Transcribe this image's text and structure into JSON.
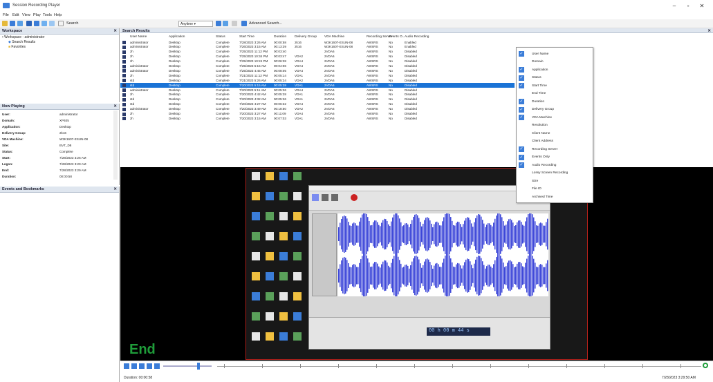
{
  "window": {
    "title": "Session Recording Player"
  },
  "menu": [
    "File",
    "Edit",
    "View",
    "Play",
    "Tools",
    "Help"
  ],
  "toolbar": {
    "search_label": "Search",
    "time_filter": "Anytime",
    "advanced_search": "Advanced Search..."
  },
  "workspace": {
    "title": "Workspace",
    "root": "Workspace - administrator",
    "items": [
      "Search Results",
      "Favorites"
    ]
  },
  "search_results": {
    "title": "Search Results",
    "columns": [
      "User Name",
      "Application",
      "Status",
      "Start Time",
      "Duration",
      "Delivery Group",
      "VDA Machine",
      "Recording Server",
      "Events O...",
      "Audio Recording"
    ],
    "rows": [
      [
        "administrator",
        "Desktop",
        "Complete",
        "7/28/2023 3:26 AM",
        "00:00:58",
        "2k16",
        "W2K1607-ESUN-08",
        "AWSRS",
        "No",
        "Enabled"
      ],
      [
        "administrator",
        "Desktop",
        "Complete",
        "7/26/2023 3:15 AM",
        "00:13:39",
        "2k16",
        "W2K1607-ESUN-08",
        "AWSRS",
        "No",
        "Enabled"
      ],
      [
        "zh",
        "Desktop",
        "Complete",
        "7/25/2023 11:12 PM",
        "00:03:40",
        "",
        "2VDA6",
        "AWSRS",
        "No",
        "Disabled"
      ],
      [
        "zh",
        "Desktop",
        "Complete",
        "7/25/2023 10:34 PM",
        "00:03:47",
        "VDA2",
        "2VDA6",
        "AWSRS",
        "No",
        "Disabled"
      ],
      [
        "zh",
        "Desktop",
        "Complete",
        "7/25/2023 10:24 PM",
        "00:06:28",
        "VDA4",
        "2VDA6",
        "AWSRS",
        "No",
        "Disabled"
      ],
      [
        "administrator",
        "Desktop",
        "Complete",
        "7/25/2023 5:15 AM",
        "00:04:06",
        "VDA4",
        "2VDA6",
        "AWSRS",
        "No",
        "Disabled"
      ],
      [
        "administrator",
        "Desktop",
        "Complete",
        "7/25/2023 4:45 AM",
        "00:08:05",
        "VDA4",
        "2VDA6",
        "AWSRS",
        "No",
        "Disabled"
      ],
      [
        "zh",
        "Desktop",
        "Complete",
        "7/21/2023 11:12 PM",
        "00:05:14",
        "VDA1",
        "2VDA6",
        "AWSRS",
        "No",
        "Disabled"
      ],
      [
        "std",
        "Desktop",
        "Complete",
        "7/21/2023 5:26 AM",
        "00:05:24",
        "VDA2",
        "2VDA6",
        "AWSRS",
        "No",
        "Disabled"
      ],
      [
        "std",
        "Desktop",
        "Complete",
        "7/20/2023 5:15 AM",
        "00:05:28",
        "VDA1",
        "2VDA6",
        "AWSRS",
        "No",
        "Disabled"
      ],
      [
        "administrator",
        "Desktop",
        "Complete",
        "7/20/2023 5:11 AM",
        "00:05:26",
        "VDA4",
        "2VDA6",
        "AWSRS",
        "No",
        "Disabled"
      ],
      [
        "zh",
        "Desktop",
        "Complete",
        "7/20/2023 4:42 AM",
        "00:05:28",
        "VDA1",
        "2VDA6",
        "AWSRS",
        "No",
        "Disabled"
      ],
      [
        "std",
        "Desktop",
        "Complete",
        "7/20/2023 4:32 AM",
        "00:05:26",
        "VDA1",
        "2VDA6",
        "AWSRS",
        "No",
        "Disabled"
      ],
      [
        "std",
        "Desktop",
        "Complete",
        "7/20/2023 4:27 AM",
        "00:06:32",
        "VDA4",
        "2VDA6",
        "AWSRS",
        "No",
        "Disabled"
      ],
      [
        "administrator",
        "Desktop",
        "Complete",
        "7/20/2023 3:49 AM",
        "00:18:50",
        "VDA2",
        "2VDA6",
        "AWSRS",
        "No",
        "Disabled"
      ],
      [
        "zh",
        "Desktop",
        "Complete",
        "7/20/2023 3:27 AM",
        "00:11:09",
        "VDA4",
        "2VDA6",
        "AWSRS",
        "No",
        "Disabled"
      ],
      [
        "zh",
        "Desktop",
        "Complete",
        "7/20/2023 3:15 AM",
        "00:07:03",
        "VDA1",
        "2VDA6",
        "AWSRS",
        "No",
        "Disabled"
      ]
    ],
    "selected_row": 9
  },
  "context_menu": [
    {
      "label": "User Name",
      "checked": true
    },
    {
      "label": "Domain",
      "checked": false
    },
    {
      "label": "Application",
      "checked": true
    },
    {
      "label": "Status",
      "checked": true
    },
    {
      "label": "Start Time",
      "checked": true
    },
    {
      "label": "End Time",
      "checked": false
    },
    {
      "label": "Duration",
      "checked": true
    },
    {
      "label": "Delivery Group",
      "checked": true
    },
    {
      "label": "VDA Machine",
      "checked": true
    },
    {
      "label": "Resolution",
      "checked": false
    },
    {
      "label": "Client Name",
      "checked": false
    },
    {
      "label": "Client Address",
      "checked": false
    },
    {
      "label": "Recording Server",
      "checked": true
    },
    {
      "label": "Events Only",
      "checked": true
    },
    {
      "label": "Audio Recording",
      "checked": true
    },
    {
      "label": "Lossy Screen Recording",
      "checked": false
    },
    {
      "label": "Size",
      "checked": false
    },
    {
      "label": "File ID",
      "checked": false
    },
    {
      "label": "Archived Time",
      "checked": false
    }
  ],
  "now_playing": {
    "title": "Now Playing",
    "fields": [
      {
        "k": "User:",
        "v": "administrator"
      },
      {
        "k": "Domain:",
        "v": "XP405"
      },
      {
        "k": "Application:",
        "v": "Desktop"
      },
      {
        "k": "Delivery Group:",
        "v": "2k16"
      },
      {
        "k": "VDA Machine:",
        "v": "W2K1607-ESUN-08"
      },
      {
        "k": "Site:",
        "v": "BVT_D8"
      },
      {
        "k": "Status:",
        "v": "Complete"
      },
      {
        "k": "Start:",
        "v": "7/28/2023 3:26 AM"
      },
      {
        "k": "Logon:",
        "v": "7/28/2023 3:29 AM"
      },
      {
        "k": "End:",
        "v": "7/28/2023 3:29 AM"
      },
      {
        "k": "Duration:",
        "v": "00:00:58"
      }
    ]
  },
  "events": {
    "title": "Events and Bookmarks"
  },
  "player": {
    "end_label": "End",
    "duration": "Duration: 00:00:58",
    "timestamp": "7/28/2023 3:29:50 AM",
    "progress": 1.0,
    "time_display": "00 h 00 m 44 s"
  },
  "colors": {
    "accent": "#1a73d6",
    "panel_header": "#dfe6ef",
    "end_green": "#1f9d3a",
    "waveform": "#3b45d8"
  }
}
